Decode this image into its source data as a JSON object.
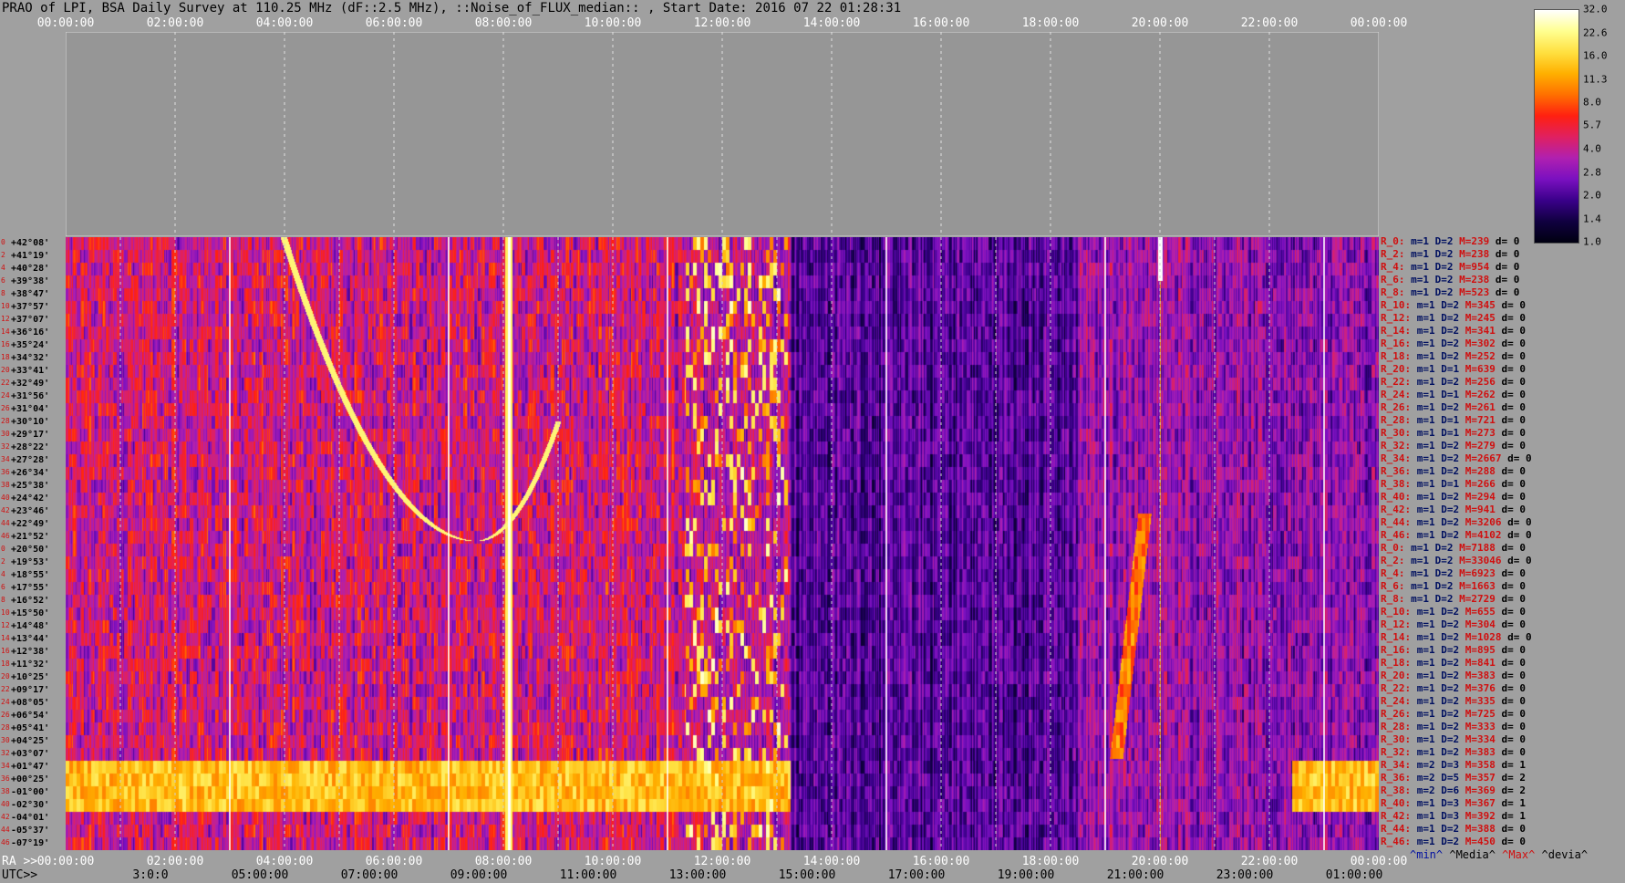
{
  "title": "PRAO of LPI, BSA Daily Survey at 110.25 MHz (dF::2.5 MHz), ::Noise_of_FLUX_median:: , Start Date: 2016 07 22 01:28:31",
  "top_ticks": [
    "00:00:00",
    "02:00:00",
    "04:00:00",
    "06:00:00",
    "08:00:00",
    "10:00:00",
    "12:00:00",
    "14:00:00",
    "16:00:00",
    "18:00:00",
    "20:00:00",
    "22:00:00",
    "00:00:00"
  ],
  "ra_lead": "RA >>",
  "ra_ticks": [
    "00:00:00",
    "02:00:00",
    "04:00:00",
    "06:00:00",
    "08:00:00",
    "10:00:00",
    "12:00:00",
    "14:00:00",
    "16:00:00",
    "18:00:00",
    "20:00:00",
    "22:00:00",
    "00:00:00"
  ],
  "utc_lead": "UTC>>",
  "utc_ticks": [
    "3:0:0",
    "05:00:00",
    "07:00:00",
    "09:00:00",
    "11:00:00",
    "13:00:00",
    "15:00:00",
    "17:00:00",
    "19:00:00",
    "21:00:00",
    "23:00:00",
    "01:00:00"
  ],
  "declinations": [
    "+42°08'",
    "+41°19'",
    "+40°28'",
    "+39°38'",
    "+38°47'",
    "+37°57'",
    "+37°07'",
    "+36°16'",
    "+35°24'",
    "+34°32'",
    "+33°41'",
    "+32°49'",
    "+31°56'",
    "+31°04'",
    "+30°10'",
    "+29°17'",
    "+28°22'",
    "+27°28'",
    "+26°34'",
    "+25°38'",
    "+24°42'",
    "+23°46'",
    "+22°49'",
    "+21°52'",
    "+20°50'",
    "+19°53'",
    "+18°55'",
    "+17°55'",
    "+16°52'",
    "+15°50'",
    "+14°48'",
    "+13°44'",
    "+12°38'",
    "+11°32'",
    "+10°25'",
    "+09°17'",
    "+08°05'",
    "+06°54'",
    "+05°41'",
    "+04°25'",
    "+03°07'",
    "+01°47'",
    "+00°25'",
    "-01°00'",
    "-02°30'",
    "-04°01'",
    "-05°37'",
    "-07°19'"
  ],
  "stats": [
    {
      "label": "R_0:",
      "m": "m=1",
      "D": "D=2",
      "M": "M=239",
      "d": "d= 0"
    },
    {
      "label": "R_2:",
      "m": "m=1",
      "D": "D=2",
      "M": "M=238",
      "d": "d= 0"
    },
    {
      "label": "R_4:",
      "m": "m=1",
      "D": "D=2",
      "M": "M=954",
      "d": "d= 0"
    },
    {
      "label": "R_6:",
      "m": "m=1",
      "D": "D=2",
      "M": "M=238",
      "d": "d= 0"
    },
    {
      "label": "R_8:",
      "m": "m=1",
      "D": "D=2",
      "M": "M=523",
      "d": "d= 0"
    },
    {
      "label": "R_10:",
      "m": "m=1",
      "D": "D=2",
      "M": "M=345",
      "d": "d= 0"
    },
    {
      "label": "R_12:",
      "m": "m=1",
      "D": "D=2",
      "M": "M=245",
      "d": "d= 0"
    },
    {
      "label": "R_14:",
      "m": "m=1",
      "D": "D=2",
      "M": "M=341",
      "d": "d= 0"
    },
    {
      "label": "R_16:",
      "m": "m=1",
      "D": "D=2",
      "M": "M=302",
      "d": "d= 0"
    },
    {
      "label": "R_18:",
      "m": "m=1",
      "D": "D=2",
      "M": "M=252",
      "d": "d= 0"
    },
    {
      "label": "R_20:",
      "m": "m=1",
      "D": "D=1",
      "M": "M=639",
      "d": "d= 0"
    },
    {
      "label": "R_22:",
      "m": "m=1",
      "D": "D=2",
      "M": "M=256",
      "d": "d= 0"
    },
    {
      "label": "R_24:",
      "m": "m=1",
      "D": "D=1",
      "M": "M=262",
      "d": "d= 0"
    },
    {
      "label": "R_26:",
      "m": "m=1",
      "D": "D=2",
      "M": "M=261",
      "d": "d= 0"
    },
    {
      "label": "R_28:",
      "m": "m=1",
      "D": "D=1",
      "M": "M=721",
      "d": "d= 0"
    },
    {
      "label": "R_30:",
      "m": "m=1",
      "D": "D=1",
      "M": "M=273",
      "d": "d= 0"
    },
    {
      "label": "R_32:",
      "m": "m=1",
      "D": "D=2",
      "M": "M=279",
      "d": "d= 0"
    },
    {
      "label": "R_34:",
      "m": "m=1",
      "D": "D=2",
      "M": "M=2667",
      "d": "d= 0"
    },
    {
      "label": "R_36:",
      "m": "m=1",
      "D": "D=2",
      "M": "M=288",
      "d": "d= 0"
    },
    {
      "label": "R_38:",
      "m": "m=1",
      "D": "D=1",
      "M": "M=266",
      "d": "d= 0"
    },
    {
      "label": "R_40:",
      "m": "m=1",
      "D": "D=2",
      "M": "M=294",
      "d": "d= 0"
    },
    {
      "label": "R_42:",
      "m": "m=1",
      "D": "D=2",
      "M": "M=941",
      "d": "d= 0"
    },
    {
      "label": "R_44:",
      "m": "m=1",
      "D": "D=2",
      "M": "M=3206",
      "d": "d= 0"
    },
    {
      "label": "R_46:",
      "m": "m=1",
      "D": "D=2",
      "M": "M=4102",
      "d": "d= 0"
    },
    {
      "label": "R_0:",
      "m": "m=1",
      "D": "D=2",
      "M": "M=7188",
      "d": "d= 0"
    },
    {
      "label": "R_2:",
      "m": "m=1",
      "D": "D=2",
      "M": "M=33046",
      "d": "d= 0"
    },
    {
      "label": "R_4:",
      "m": "m=1",
      "D": "D=2",
      "M": "M=6923",
      "d": "d= 0"
    },
    {
      "label": "R_6:",
      "m": "m=1",
      "D": "D=2",
      "M": "M=1663",
      "d": "d= 0"
    },
    {
      "label": "R_8:",
      "m": "m=1",
      "D": "D=2",
      "M": "M=2729",
      "d": "d= 0"
    },
    {
      "label": "R_10:",
      "m": "m=1",
      "D": "D=2",
      "M": "M=655",
      "d": "d= 0"
    },
    {
      "label": "R_12:",
      "m": "m=1",
      "D": "D=2",
      "M": "M=304",
      "d": "d= 0"
    },
    {
      "label": "R_14:",
      "m": "m=1",
      "D": "D=2",
      "M": "M=1028",
      "d": "d= 0"
    },
    {
      "label": "R_16:",
      "m": "m=1",
      "D": "D=2",
      "M": "M=895",
      "d": "d= 0"
    },
    {
      "label": "R_18:",
      "m": "m=1",
      "D": "D=2",
      "M": "M=841",
      "d": "d= 0"
    },
    {
      "label": "R_20:",
      "m": "m=1",
      "D": "D=2",
      "M": "M=383",
      "d": "d= 0"
    },
    {
      "label": "R_22:",
      "m": "m=1",
      "D": "D=2",
      "M": "M=376",
      "d": "d= 0"
    },
    {
      "label": "R_24:",
      "m": "m=1",
      "D": "D=2",
      "M": "M=335",
      "d": "d= 0"
    },
    {
      "label": "R_26:",
      "m": "m=1",
      "D": "D=2",
      "M": "M=725",
      "d": "d= 0"
    },
    {
      "label": "R_28:",
      "m": "m=1",
      "D": "D=2",
      "M": "M=333",
      "d": "d= 0"
    },
    {
      "label": "R_30:",
      "m": "m=1",
      "D": "D=2",
      "M": "M=334",
      "d": "d= 0"
    },
    {
      "label": "R_32:",
      "m": "m=1",
      "D": "D=2",
      "M": "M=383",
      "d": "d= 0"
    },
    {
      "label": "R_34:",
      "m": "m=2",
      "D": "D=3",
      "M": "M=358",
      "d": "d= 1"
    },
    {
      "label": "R_36:",
      "m": "m=2",
      "D": "D=5",
      "M": "M=357",
      "d": "d= 2"
    },
    {
      "label": "R_38:",
      "m": "m=2",
      "D": "D=6",
      "M": "M=369",
      "d": "d= 2"
    },
    {
      "label": "R_40:",
      "m": "m=1",
      "D": "D=3",
      "M": "M=367",
      "d": "d= 1"
    },
    {
      "label": "R_42:",
      "m": "m=1",
      "D": "D=3",
      "M": "M=392",
      "d": "d= 1"
    },
    {
      "label": "R_44:",
      "m": "m=1",
      "D": "D=2",
      "M": "M=388",
      "d": "d= 0"
    },
    {
      "label": "R_46:",
      "m": "m=1",
      "D": "D=2",
      "M": "M=450",
      "d": "d= 0"
    }
  ],
  "footer": {
    "min": "^min^",
    "median": "^Media^",
    "max": "^Max^",
    "dev": "^devia^"
  },
  "colors": {
    "background": "#a0a0a0",
    "upper_panel": "#969696",
    "label_red": "#d01010",
    "label_navy": "#001060"
  },
  "chart_data": {
    "type": "heatmap",
    "x_axis": "RA (hh:mm:ss)",
    "x_range": [
      "00:00:00",
      "00:00:00"
    ],
    "x_ticks": [
      "00:00:00",
      "02:00:00",
      "04:00:00",
      "06:00:00",
      "08:00:00",
      "10:00:00",
      "12:00:00",
      "14:00:00",
      "16:00:00",
      "18:00:00",
      "20:00:00",
      "22:00:00",
      "00:00:00"
    ],
    "utc_ticks": [
      "3:0:0",
      "05:00:00",
      "07:00:00",
      "09:00:00",
      "11:00:00",
      "13:00:00",
      "15:00:00",
      "17:00:00",
      "19:00:00",
      "21:00:00",
      "23:00:00",
      "01:00:00"
    ],
    "y_rows": 48,
    "colorbar_ticks": [
      32.0,
      22.6,
      16.0,
      11.3,
      8.0,
      5.7,
      4.0,
      2.8,
      2.0,
      1.4,
      1.0
    ],
    "colorbar_range": [
      1.0,
      32.0
    ],
    "colorbar_scale": "log",
    "colormap": [
      "#000010",
      "#100040",
      "#3a008a",
      "#7a10c0",
      "#b020b0",
      "#e02060",
      "#ff2010",
      "#ff7000",
      "#ffb000",
      "#ffe040",
      "#ffff90",
      "#ffffff"
    ],
    "features": [
      {
        "kind": "vertical_bright_source",
        "ra_hours": 8.1,
        "value": 32
      },
      {
        "kind": "curved_track",
        "ra_hours_start": 4.2,
        "ra_hours_vertex": 7.5,
        "ra_hours_end": 10.0,
        "value": 16
      },
      {
        "kind": "vertical_bright_source",
        "ra_hours": 20.0,
        "value": 32
      },
      {
        "kind": "horizontal_band",
        "dec_rows": [
          41,
          44
        ],
        "value": 11.3
      },
      {
        "kind": "rfi_region",
        "ra_hours_start": 11.3,
        "ra_hours_end": 13.2,
        "value": 11.3
      }
    ],
    "grid": true,
    "legend": "right"
  }
}
